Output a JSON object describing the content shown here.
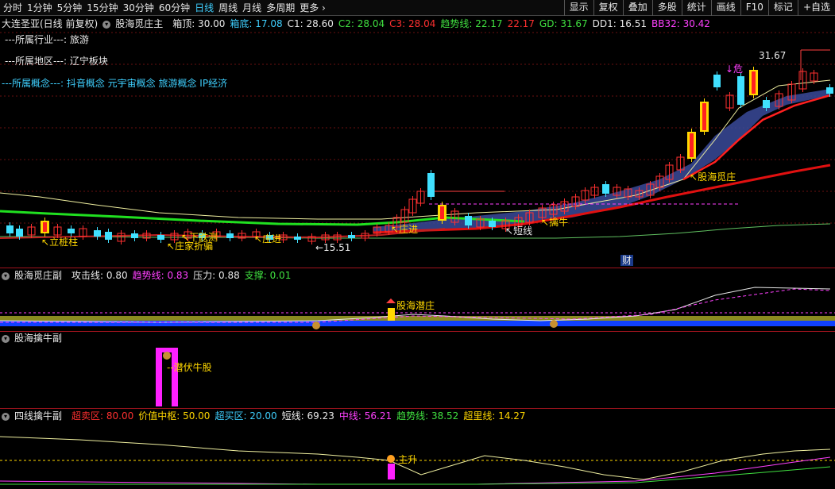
{
  "toolbar": {
    "periods": [
      "分时",
      "1分钟",
      "5分钟",
      "15分钟",
      "30分钟",
      "60分钟",
      "日线",
      "周线",
      "月线",
      "多周期",
      "更多 ›"
    ],
    "active_period": "日线",
    "actions": [
      "显示",
      "复权",
      "叠加",
      "多股",
      "统计",
      "画线",
      "F10",
      "标记",
      "+自选"
    ]
  },
  "main_header": {
    "stock_name": "大连圣亚(日线 前复权)",
    "indicator": "股海觅庄主",
    "items": [
      {
        "label": "箱顶: 30.00",
        "color": "#e8e8e8"
      },
      {
        "label": "箱底: 17.08",
        "color": "#3fd0ff"
      },
      {
        "label": "C1: 28.60",
        "color": "#e8e8e8"
      },
      {
        "label": "C2: 28.04",
        "color": "#40e040"
      },
      {
        "label": "C3: 28.04",
        "color": "#ff3030"
      },
      {
        "label": "趋势线: 22.17",
        "color": "#40e040"
      },
      {
        "label": "22.17",
        "color": "#ff3030"
      },
      {
        "label": "GD: 31.67",
        "color": "#40e040"
      },
      {
        "label": "DD1: 16.51",
        "color": "#e8e8e8"
      },
      {
        "label": "BB32: 30.42",
        "color": "#ff40ff"
      }
    ]
  },
  "info": {
    "industry": "---所属行业---: 旅游",
    "region": "---所属地区---: 辽宁板块",
    "concept_label": "---所属概念---:",
    "concepts": "抖音概念 元宇宙概念 旅游概念 IP经济"
  },
  "annotations": {
    "high_label": "31.67",
    "danger_label": "↓危",
    "zhuang": "股海觅庄",
    "zhuang_jin": "庄进",
    "duanxian": "短线",
    "qinniu": "擒牛",
    "lizhuang": "立桩柱",
    "zhuangjia_zhe": "庄家折骗",
    "xiadiezhi": "下跌测",
    "zhuangjin2": "庄进",
    "low_label": "←15.51",
    "cai": "财"
  },
  "panel2": {
    "title": "股海觅庄副",
    "items": [
      {
        "label": "攻击线: 0.80",
        "color": "#e8e8e8"
      },
      {
        "label": "趋势线: 0.83",
        "color": "#ff40ff"
      },
      {
        "label": "压力: 0.88",
        "color": "#e8e8e8"
      },
      {
        "label": "支撑: 0.01",
        "color": "#40e040"
      }
    ],
    "signal": "股海潜庄"
  },
  "panel3": {
    "title": "股海擒牛副",
    "signal": "潜伏牛股"
  },
  "panel4": {
    "title": "四线擒牛副",
    "items": [
      {
        "label": "超卖区: 80.00",
        "color": "#ff3030"
      },
      {
        "label": "价值中枢: 50.00",
        "color": "#ffd700"
      },
      {
        "label": "超买区: 20.00",
        "color": "#3fd0ff"
      },
      {
        "label": "短线: 69.23",
        "color": "#e8e8e8"
      },
      {
        "label": "中线: 56.21",
        "color": "#ff40ff"
      },
      {
        "label": "趋势线: 38.52",
        "color": "#40e040"
      },
      {
        "label": "超里线: 14.27",
        "color": "#ffd700"
      }
    ],
    "signal": "主升"
  },
  "colors": {
    "up": "#ff3030",
    "down": "#40e0ff",
    "ma_white": "#e8e8e8",
    "ma_green": "#20e020",
    "ma_red": "#e01010",
    "band": "#3a4a9a"
  }
}
